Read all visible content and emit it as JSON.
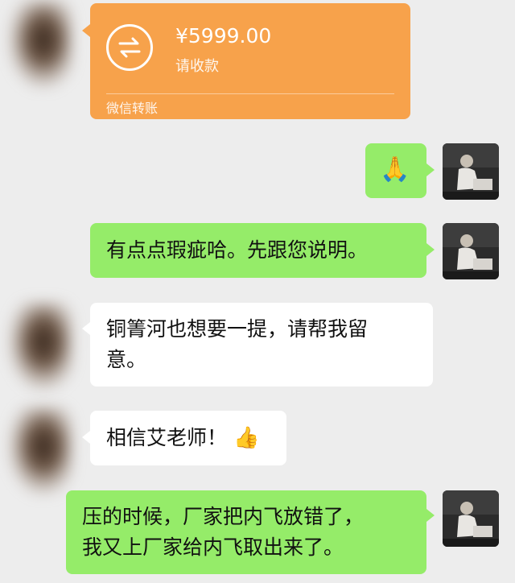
{
  "transfer": {
    "amount": "¥5999.00",
    "status": "请收款",
    "footer": "微信转账",
    "icon": "transfer-arrows-icon",
    "color": "#f7a24b"
  },
  "messages": [
    {
      "side": "right",
      "type": "emoji",
      "emoji": "🙏",
      "emoji_name": "praying-hands-emoji"
    },
    {
      "side": "right",
      "type": "text",
      "text": "有点点瑕疵哈。先跟您说明。"
    },
    {
      "side": "left",
      "type": "text",
      "lines": [
        "铜箐河也想要一提，请帮我留",
        "意。"
      ]
    },
    {
      "side": "left",
      "type": "text",
      "text": "相信艾老师！",
      "emoji": "👍",
      "emoji_name": "thumbs-up-emoji"
    },
    {
      "side": "left",
      "type": "text",
      "lines": [
        "压的时候，厂家把内飞放错了，",
        "我又上厂家给内飞取出来了。"
      ]
    }
  ],
  "colors": {
    "background": "#ededed",
    "green_bubble": "#95ec69",
    "white_bubble": "#ffffff"
  }
}
